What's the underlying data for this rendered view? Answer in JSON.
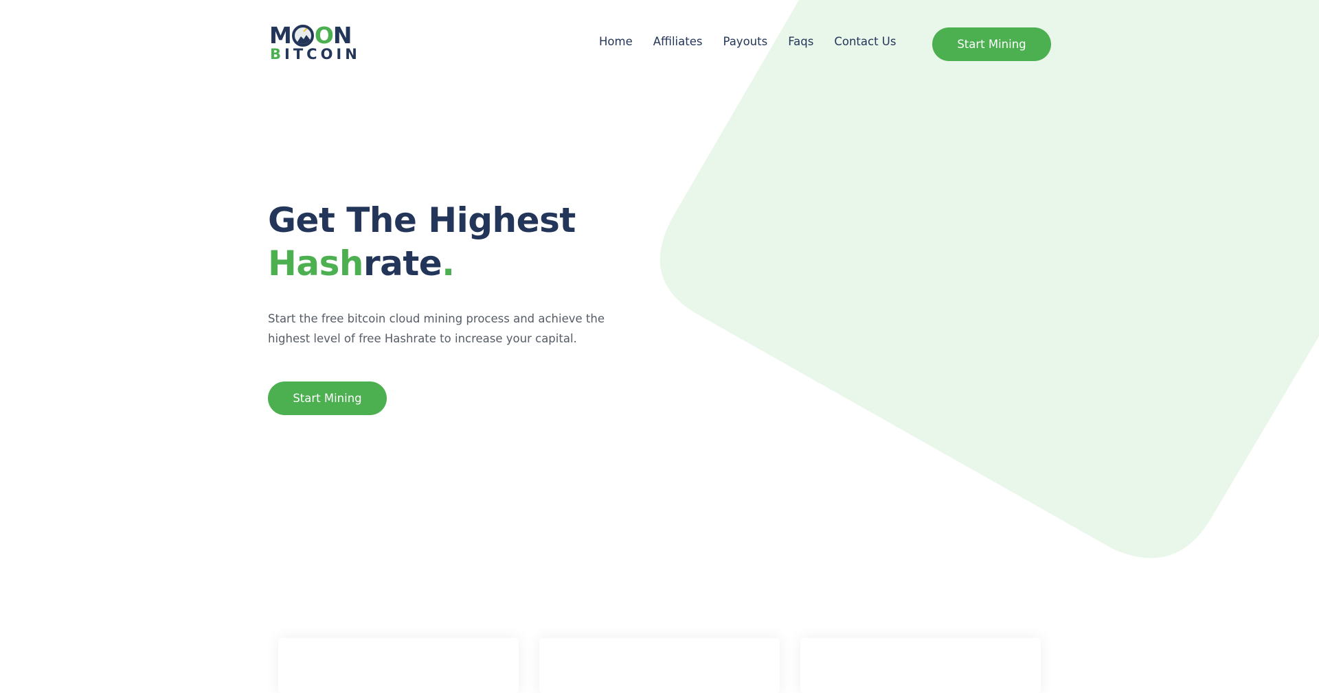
{
  "logo": {
    "top_left": "M",
    "top_moon": "O",
    "top_right": "N",
    "bottom_first": "B",
    "bottom_rest": "ITCOIN"
  },
  "nav": {
    "home": "Home",
    "affiliates": "Affiliates",
    "payouts": "Payouts",
    "faqs": "Faqs",
    "contact": "Contact Us"
  },
  "header_cta": "Start Mining",
  "hero": {
    "title_line1": "Get The Highest",
    "title_green": "Hash",
    "title_rest": "rate",
    "title_dot": ".",
    "description": "Start the free bitcoin cloud mining process and achieve the highest level of free Hashrate to increase your capital.",
    "cta": "Start Mining"
  },
  "colors": {
    "brand_green": "#4caf50",
    "navy": "#233559",
    "shape_bg": "#e9f6ea"
  }
}
